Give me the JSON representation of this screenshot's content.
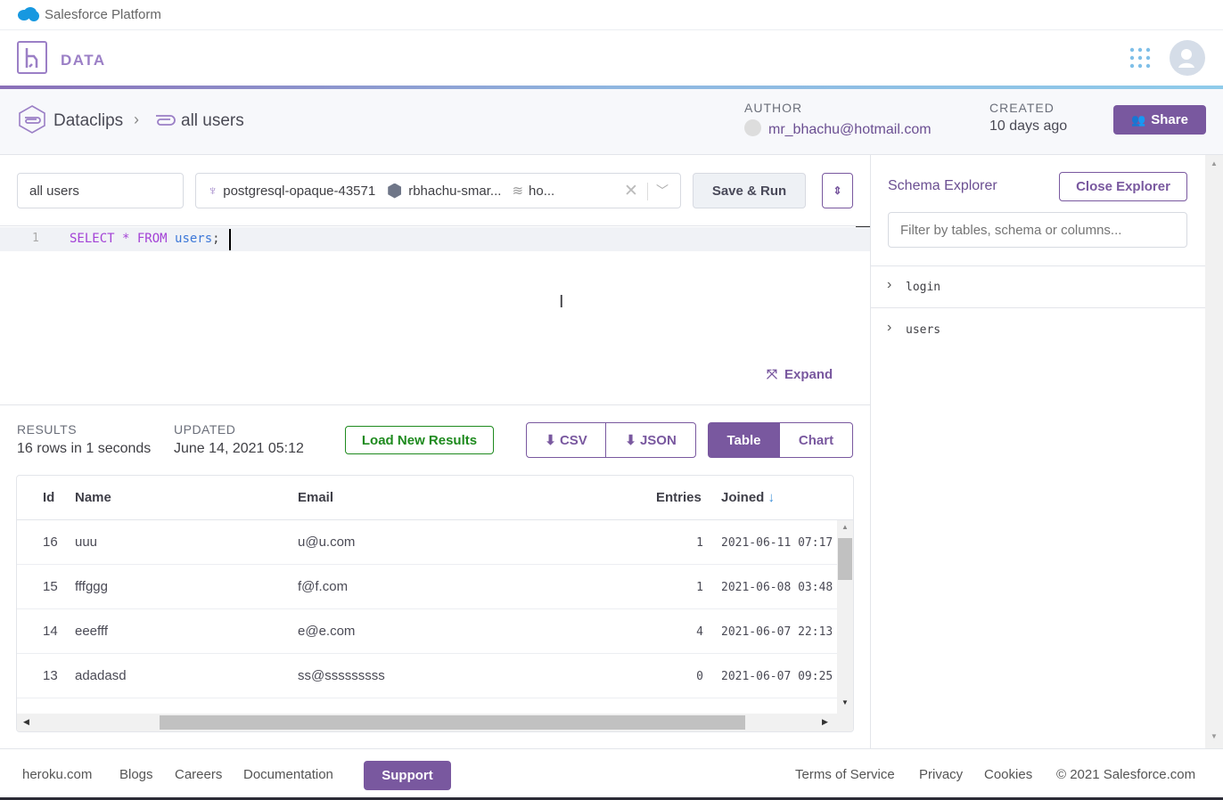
{
  "topbar": {
    "title": "Salesforce Platform"
  },
  "header": {
    "app": "DATA"
  },
  "breadcrumb": {
    "root": "Dataclips",
    "current": "all users"
  },
  "meta": {
    "author_label": "AUTHOR",
    "author": "mr_bhachu@hotmail.com",
    "created_label": "CREATED",
    "created": "10 days ago",
    "share": "Share"
  },
  "editor": {
    "name": "all users",
    "db": "postgresql-opaque-43571",
    "app": "rbhachu-smar...",
    "addon": "ho...",
    "save_run": "Save & Run",
    "line": "1",
    "sql": [
      {
        "t": "SELECT",
        "c": "kw"
      },
      {
        "t": " * ",
        "c": "op"
      },
      {
        "t": "FROM",
        "c": "kw"
      },
      {
        "t": " users",
        "c": "id"
      },
      {
        "t": ";",
        "c": "p"
      }
    ],
    "expand": "Expand"
  },
  "results": {
    "results_label": "RESULTS",
    "summary": "16 rows in 1 seconds",
    "updated_label": "UPDATED",
    "updated": "June 14, 2021 05:12",
    "load_new": "Load New Results",
    "csv": "CSV",
    "json": "JSON",
    "table": "Table",
    "chart": "Chart"
  },
  "table": {
    "columns": [
      "Id",
      "Name",
      "Email",
      "Entries",
      "Joined"
    ],
    "rows": [
      [
        "16",
        "uuu",
        "u@u.com",
        "1",
        "2021-06-11 07:17"
      ],
      [
        "15",
        "fffggg",
        "f@f.com",
        "1",
        "2021-06-08 03:48"
      ],
      [
        "14",
        "eeefff",
        "e@e.com",
        "4",
        "2021-06-07 22:13"
      ],
      [
        "13",
        "adadasd",
        "ss@sssssssss",
        "0",
        "2021-06-07 09:25"
      ]
    ]
  },
  "explorer": {
    "title": "Schema Explorer",
    "close": "Close Explorer",
    "filter_placeholder": "Filter by tables, schema or columns...",
    "tables": [
      "login",
      "users"
    ]
  },
  "footer": {
    "left": [
      "heroku.com",
      "Blogs",
      "Careers",
      "Documentation"
    ],
    "support": "Support",
    "right": [
      "Terms of Service",
      "Privacy",
      "Cookies"
    ],
    "copyright": "© 2021 Salesforce.com"
  },
  "colors": {
    "brand": "#79589f",
    "green": "#1e8a1e",
    "sql_keyword": "#a342d6",
    "sql_identifier": "#3d78d8"
  }
}
